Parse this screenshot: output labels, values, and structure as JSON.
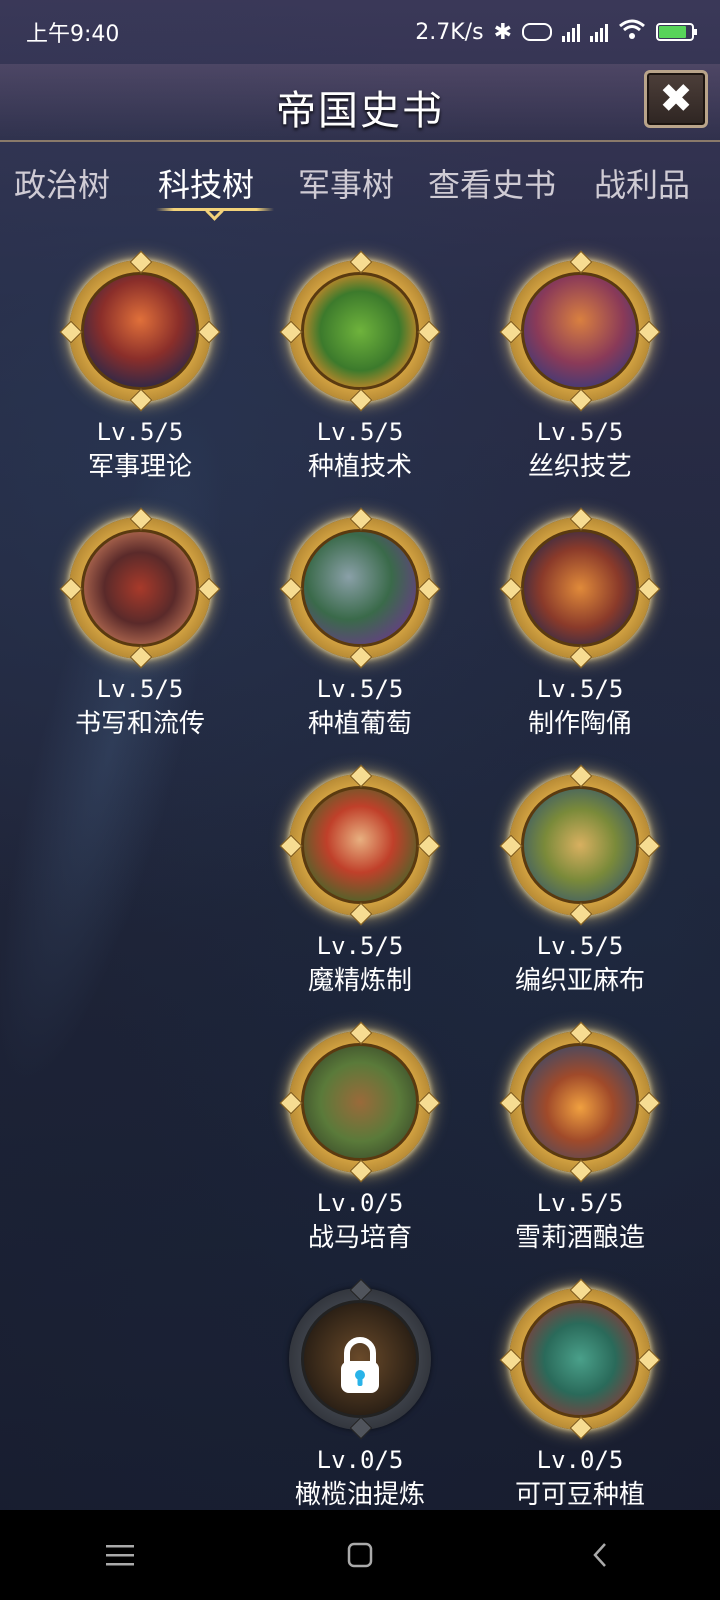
{
  "status_bar": {
    "time": "上午9:40",
    "net_speed": "2.7K/s"
  },
  "header": {
    "title": "帝国史书"
  },
  "tabs": [
    {
      "label": "政治树"
    },
    {
      "label": "科技树"
    },
    {
      "label": "军事树"
    },
    {
      "label": "查看史书"
    },
    {
      "label": "战利品"
    }
  ],
  "active_tab": "科技树",
  "nodes": [
    {
      "level": "Lv.5/5",
      "name": "军事理论",
      "icon": "knight-on-horse-icon"
    },
    {
      "level": "Lv.5/5",
      "name": "种植技术",
      "icon": "farmland-icon"
    },
    {
      "level": "Lv.5/5",
      "name": "丝织技艺",
      "icon": "weaving-house-icon"
    },
    {
      "level": "Lv.5/5",
      "name": "书写和流传",
      "icon": "warrior-statue-icon"
    },
    {
      "level": "Lv.5/5",
      "name": "种植葡萄",
      "icon": "vineyard-ruin-icon"
    },
    {
      "level": "Lv.5/5",
      "name": "制作陶俑",
      "icon": "terracotta-figure-icon"
    },
    {
      "level": "Lv.5/5",
      "name": "魔精炼制",
      "icon": "alchemist-woman-icon"
    },
    {
      "level": "Lv.5/5",
      "name": "编织亚麻布",
      "icon": "linen-path-icon"
    },
    {
      "level": "Lv.0/5",
      "name": "战马培育",
      "icon": "cavalry-battle-icon"
    },
    {
      "level": "Lv.5/5",
      "name": "雪莉酒酿造",
      "icon": "wine-jar-icon"
    },
    {
      "level": "Lv.0/5",
      "name": "橄榄油提炼",
      "icon": "lock-icon",
      "locked": true
    },
    {
      "level": "Lv.0/5",
      "name": "可可豆种植",
      "icon": "stone-head-icon"
    }
  ],
  "colors": {
    "gold": "#f2d27a",
    "active_tab": "#ffffff",
    "inactive_tab": "#cfcbd4",
    "lock": "#29b3e8"
  }
}
